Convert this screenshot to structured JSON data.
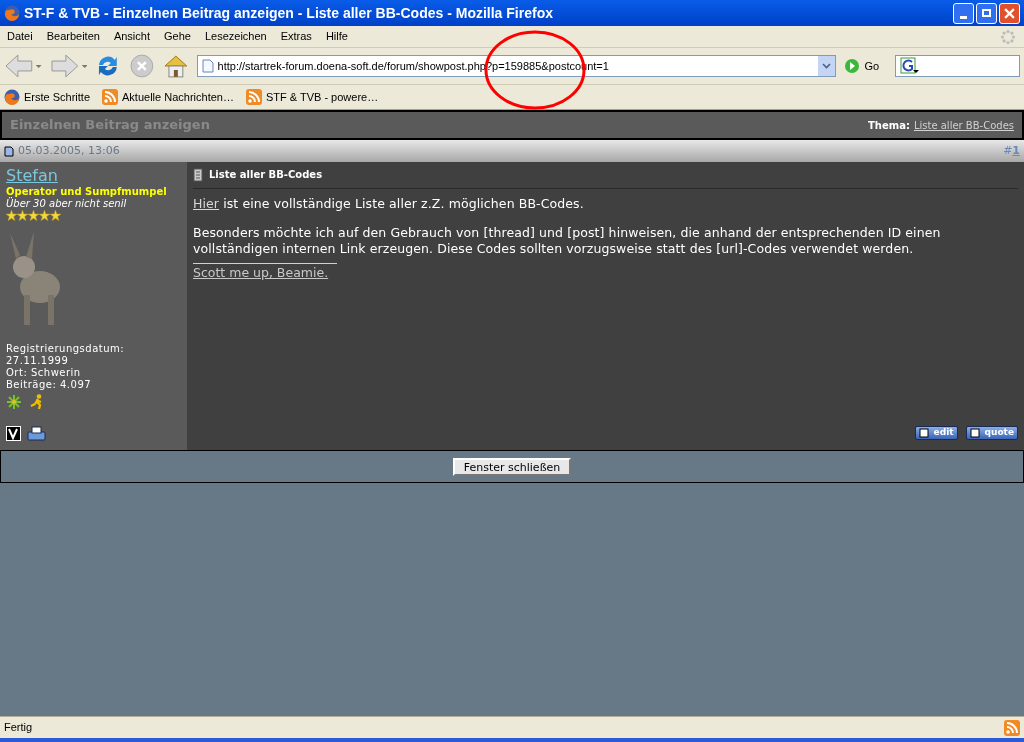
{
  "window": {
    "title": "ST-F & TVB - Einzelnen Beitrag anzeigen - Liste aller BB-Codes - Mozilla Firefox"
  },
  "menu": [
    "Datei",
    "Bearbeiten",
    "Ansicht",
    "Gehe",
    "Lesezeichen",
    "Extras",
    "Hilfe"
  ],
  "address_bar": {
    "value": "http://startrek-forum.doena-soft.de/forum/showpost.php?p=159885&postcount=1",
    "go_label": "Go"
  },
  "bookmarks": [
    {
      "label": "Erste Schritte",
      "kind": "page"
    },
    {
      "label": "Aktuelle Nachrichten…",
      "kind": "feed"
    },
    {
      "label": "STF & TVB - powere…",
      "kind": "feed"
    }
  ],
  "page": {
    "heading": "Einzelnen Beitrag anzeigen",
    "thread_label": "Thema:",
    "thread_link": "Liste aller BB-Codes",
    "post": {
      "date": "05.03.2005, 13:06",
      "number_prefix": "#",
      "number": "1",
      "author": {
        "name": "Stefan",
        "rank": "Operator und Sumpfmumpel",
        "user_title": "Über 30 aber nicht senil",
        "stars": 5,
        "details": [
          "Registrierungsdatum:",
          "27.11.1999",
          "Ort: Schwerin",
          "Beiträge: 4.097"
        ]
      },
      "title": "Liste aller BB-Codes",
      "body": [
        {
          "link": "Hier",
          "text": " ist eine vollständige Liste aller z.Z. möglichen BB-Codes."
        },
        {
          "text": "Besonders möchte ich auf den Gebrauch von [thread] und [post] hinweisen, die anhand der entsprechenden ID einen vollständigen internen Link erzeugen. Diese Codes sollten vorzugsweise statt des [url]-Codes verwendet werden."
        }
      ],
      "signature": "Scott me up, Beamie.",
      "buttons": [
        "edit",
        "quote"
      ]
    },
    "close_button": "Fenster schließen"
  },
  "status_bar": {
    "text": "Fertig"
  }
}
